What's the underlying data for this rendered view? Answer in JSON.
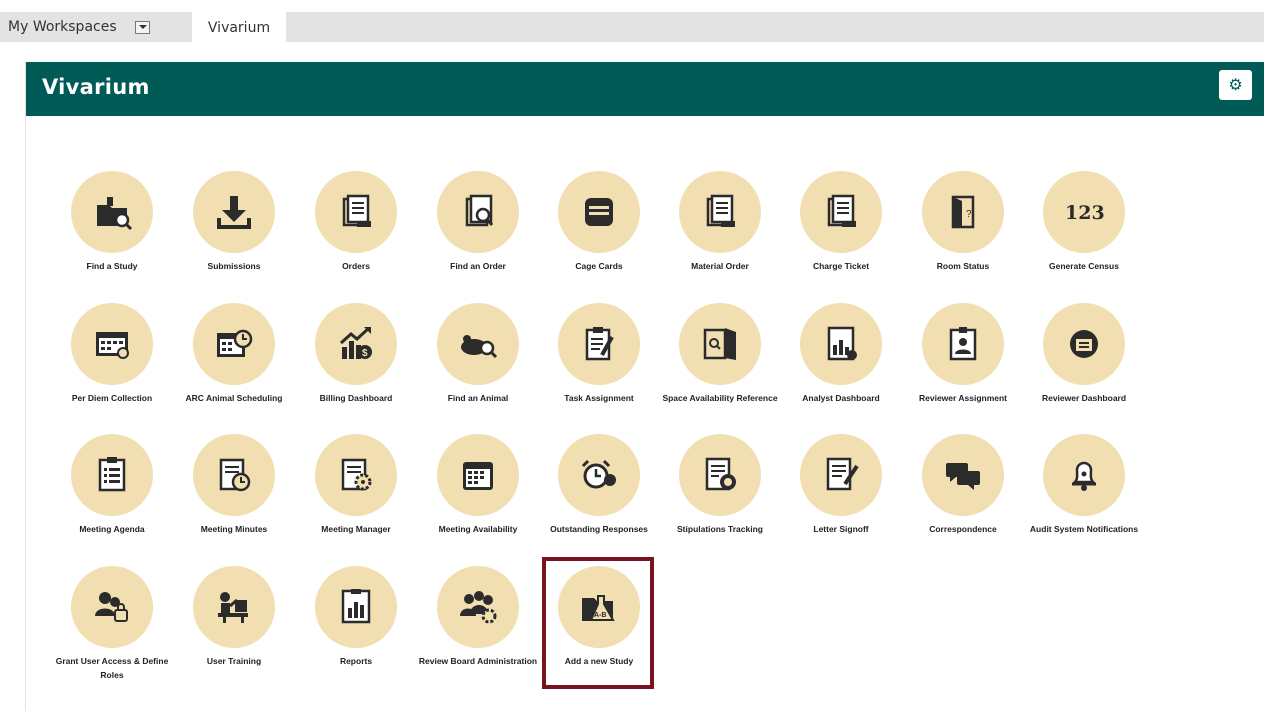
{
  "tabs": {
    "workspaces_label": "My Workspaces",
    "active_label": "Vivarium"
  },
  "panel": {
    "title": "Vivarium",
    "header_color": "#005a55",
    "gear_icon": "gear-icon"
  },
  "tiles": [
    {
      "label": "Find a Study",
      "icon": "folder-search-icon"
    },
    {
      "label": "Submissions",
      "icon": "download-icon"
    },
    {
      "label": "Orders",
      "icon": "document-stack-icon"
    },
    {
      "label": "Find an Order",
      "icon": "document-search-icon"
    },
    {
      "label": "Cage Cards",
      "icon": "card-stack-icon"
    },
    {
      "label": "Material Order",
      "icon": "document-stack-icon"
    },
    {
      "label": "Charge Ticket",
      "icon": "document-stack-icon"
    },
    {
      "label": "Room Status",
      "icon": "door-icon"
    },
    {
      "label": "Generate Census",
      "icon": "numbers-icon",
      "icon_text": "123"
    },
    {
      "label": "Per Diem Collection",
      "icon": "calendar-icon"
    },
    {
      "label": "ARC Animal Scheduling",
      "icon": "calendar-clock-icon"
    },
    {
      "label": "Billing Dashboard",
      "icon": "chart-growth-icon"
    },
    {
      "label": "Find an Animal",
      "icon": "mouse-search-icon"
    },
    {
      "label": "Task Assignment",
      "icon": "clipboard-pencil-icon"
    },
    {
      "label": "Space Availability Reference",
      "icon": "open-door-icon"
    },
    {
      "label": "Analyst Dashboard",
      "icon": "analytics-icon"
    },
    {
      "label": "Reviewer Assignment",
      "icon": "badge-icon"
    },
    {
      "label": "Reviewer Dashboard",
      "icon": "reviewer-icon"
    },
    {
      "label": "Meeting Agenda",
      "icon": "checklist-icon"
    },
    {
      "label": "Meeting Minutes",
      "icon": "document-clock-icon"
    },
    {
      "label": "Meeting Manager",
      "icon": "document-gear-icon"
    },
    {
      "label": "Meeting Availability",
      "icon": "calendar-grid-icon"
    },
    {
      "label": "Outstanding Responses",
      "icon": "alarm-clock-icon"
    },
    {
      "label": "Stipulations Tracking",
      "icon": "document-progress-icon"
    },
    {
      "label": "Letter Signoff",
      "icon": "document-sign-icon"
    },
    {
      "label": "Correspondence",
      "icon": "chat-bubbles-icon"
    },
    {
      "label": "Audit System Notifications",
      "icon": "bell-icon"
    },
    {
      "label": "Grant User Access & Define Roles",
      "icon": "users-lock-icon"
    },
    {
      "label": "User Training",
      "icon": "presenter-icon"
    },
    {
      "label": "Reports",
      "icon": "report-chart-icon"
    },
    {
      "label": "Review Board Administration",
      "icon": "group-gear-icon"
    },
    {
      "label": "Add a new Study",
      "icon": "folder-flask-icon"
    }
  ],
  "highlight_color": "#7a1320"
}
